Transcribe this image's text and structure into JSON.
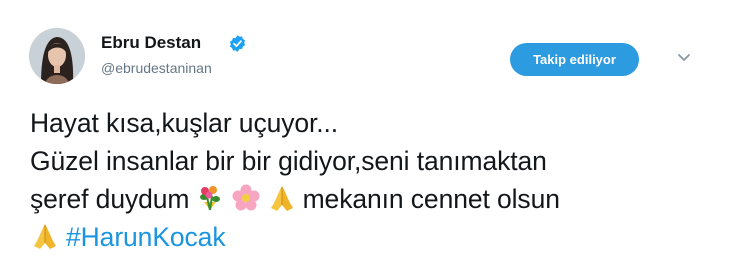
{
  "user": {
    "display_name": "Ebru Destan",
    "handle": "@ebrudestaninan",
    "verified_icon": "verified-badge-icon"
  },
  "actions": {
    "follow_label": "Takip ediliyor",
    "more_icon": "chevron-down-icon"
  },
  "tweet": {
    "line1": "Hayat kısa,kuşlar uçuyor...",
    "line2": "Güzel insanlar bir bir gidiyor,seni tanımaktan",
    "line3_text": "şeref duydum",
    "line3_suffix": "mekanın cennet olsun",
    "line3_emojis": [
      "bouquet-emoji",
      "cherry-blossom-emoji",
      "folded-hands-emoji"
    ],
    "line4_emoji": "folded-hands-emoji",
    "hashtag": "#HarunKocak"
  },
  "colors": {
    "accent": "#1b95e0",
    "button": "#2d9be0",
    "handle_gray": "#657786"
  }
}
